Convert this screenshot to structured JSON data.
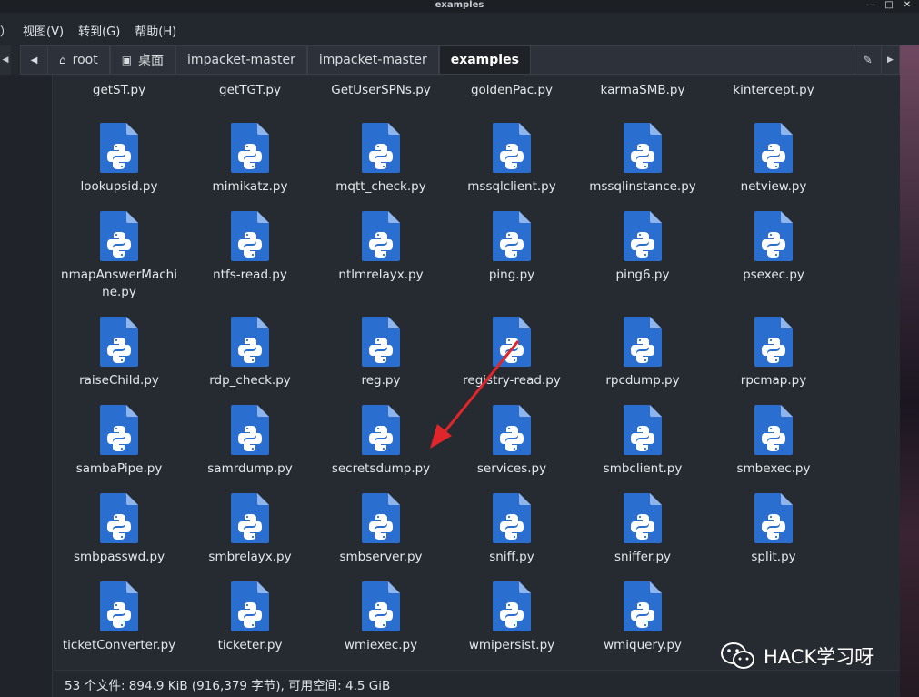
{
  "window": {
    "title": "examples"
  },
  "menu": [
    "）",
    "视图(V)",
    "转到(G)",
    "帮助(H)"
  ],
  "breadcrumb": {
    "items": [
      {
        "label": "root",
        "icon": "home-icon"
      },
      {
        "label": "桌面",
        "icon": "desktop-icon"
      },
      {
        "label": "impacket-master"
      },
      {
        "label": "impacket-master"
      },
      {
        "label": "examples"
      }
    ]
  },
  "files": [
    "getST.py",
    "getTGT.py",
    "GetUserSPNs.py",
    "goldenPac.py",
    "karmaSMB.py",
    "kintercept.py",
    "lookupsid.py",
    "mimikatz.py",
    "mqtt_check.py",
    "mssqlclient.py",
    "mssqlinstance.py",
    "netview.py",
    "nmapAnswerMachine.py",
    "ntfs-read.py",
    "ntlmrelayx.py",
    "ping.py",
    "ping6.py",
    "psexec.py",
    "raiseChild.py",
    "rdp_check.py",
    "reg.py",
    "registry-read.py",
    "rpcdump.py",
    "rpcmap.py",
    "sambaPipe.py",
    "samrdump.py",
    "secretsdump.py",
    "services.py",
    "smbclient.py",
    "smbexec.py",
    "smbpasswd.py",
    "smbrelayx.py",
    "smbserver.py",
    "sniff.py",
    "sniffer.py",
    "split.py",
    "ticketConverter.py",
    "ticketer.py",
    "wmiexec.py",
    "wmipersist.py",
    "wmiquery.py"
  ],
  "status": {
    "text": "53 个文件: 894.9 KiB (916,379 字节), 可用空间: 4.5 GiB"
  },
  "watermark": {
    "text": "HACK学习呀",
    "icon": "wechat-icon"
  },
  "colors": {
    "file_icon": "#2a6fd0",
    "arrow": "#e0262b"
  }
}
